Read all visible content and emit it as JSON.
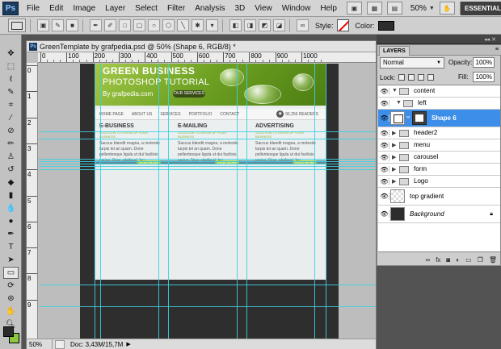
{
  "menubar": {
    "logo": "Ps",
    "items": [
      "File",
      "Edit",
      "Image",
      "Layer",
      "Select",
      "Filter",
      "Analysis",
      "3D",
      "View",
      "Window",
      "Help"
    ],
    "zoom": "50%",
    "workspace": "ESSENTIALS"
  },
  "options": {
    "style_label": "Style:",
    "color_label": "Color:",
    "fill_color": "#2d2d2d"
  },
  "toolbox": {
    "tools": [
      "move-icon",
      "marquee-icon",
      "lasso-icon",
      "quick-select-icon",
      "crop-icon",
      "eyedropper-icon",
      "healing-icon",
      "brush-icon",
      "stamp-icon",
      "history-brush-icon",
      "eraser-icon",
      "gradient-icon",
      "blur-icon",
      "dodge-icon",
      "pen-icon",
      "type-icon",
      "path-select-icon",
      "shape-icon",
      "3d-rotate-icon",
      "3d-orbit-icon",
      "hand-icon",
      "zoom-icon"
    ],
    "fg_color": "#2b2b2b",
    "bg_color": "#8cc63f"
  },
  "document": {
    "title": "GreenTemplate by grafpedia.psd @ 50% (Shape 6, RGB/8) *",
    "ruler_top": [
      "0",
      "100",
      "200",
      "300",
      "400",
      "500",
      "600",
      "700",
      "800",
      "900",
      "1000"
    ],
    "ruler_left": [
      "0",
      "1",
      "2",
      "3",
      "4",
      "5",
      "6",
      "7",
      "8",
      "9"
    ],
    "status_zoom": "50%",
    "status_doc": "Doc: 3,43M/15,7M"
  },
  "artwork": {
    "hero_title": "GREEN BUSINESS",
    "hero_subtitle": "PHOTOSHOP TUTORIAL",
    "hero_by": "By grafpedia.com",
    "hero_button": "OUR SERVICES",
    "nav": [
      "HOME PAGE",
      "ABOUT US",
      "SERVICES",
      "PORTFOLIO",
      "CONTACT"
    ],
    "rss": "96,256 READERS",
    "columns": [
      {
        "title": "E-BUSINESS",
        "subtitle": "SOLUTION TO GROW UP YOUR BUSINESS",
        "text": "Saccus blandit magna, a molestie turpis tel an quam. Done pellentesque ligula ut dui facilisis varius. Nunc eleifend, leo vestibulum laoreet hendrerit.",
        "more": "READ MORE"
      },
      {
        "title": "E-MAILING",
        "subtitle": "SOLUTION TO GROW UP YOUR BUSINESS",
        "text": "Saccus blandit magna, a molestie turpis tel an quam. Done pellentesque ligula ut dui facilisis varius. Nunc eleifend, leo vestibulum laoreet hendrerit.",
        "more": "READ MORE"
      },
      {
        "title": "ADVERTISING",
        "subtitle": "SOLUTION TO GROW UP YOUR BUSINESS",
        "text": "Saccus blandit magna, a molestie turpis tel an quam. Done pellentesque ligula ut dui facilisis varius. Nunc eleifend, leo vestibulum laoreet hendrerit.",
        "more": "READ MORE"
      }
    ]
  },
  "layers": {
    "tab": "LAYERS",
    "blend_mode": "Normal",
    "opacity_label": "Opacity:",
    "opacity": "100%",
    "lock_label": "Lock:",
    "fill_label": "Fill:",
    "fill": "100%",
    "items": [
      {
        "name": "content",
        "kind": "folder",
        "expanded": true
      },
      {
        "name": "left",
        "kind": "folder",
        "expanded": true
      },
      {
        "name": "Shape 6",
        "kind": "shape",
        "selected": true
      },
      {
        "name": "header2",
        "kind": "folder",
        "expanded": false
      },
      {
        "name": "menu",
        "kind": "folder",
        "expanded": false
      },
      {
        "name": "carousel",
        "kind": "folder",
        "expanded": false
      },
      {
        "name": "form",
        "kind": "folder",
        "expanded": false
      },
      {
        "name": "Logo",
        "kind": "folder",
        "expanded": false
      },
      {
        "name": "top gradient",
        "kind": "pixel"
      },
      {
        "name": "Background",
        "kind": "background"
      }
    ],
    "bottom_icons": [
      "link-layers-icon",
      "fx-icon",
      "add-mask-icon",
      "adjustment-icon",
      "new-group-icon",
      "new-layer-icon",
      "delete-layer-icon"
    ]
  }
}
